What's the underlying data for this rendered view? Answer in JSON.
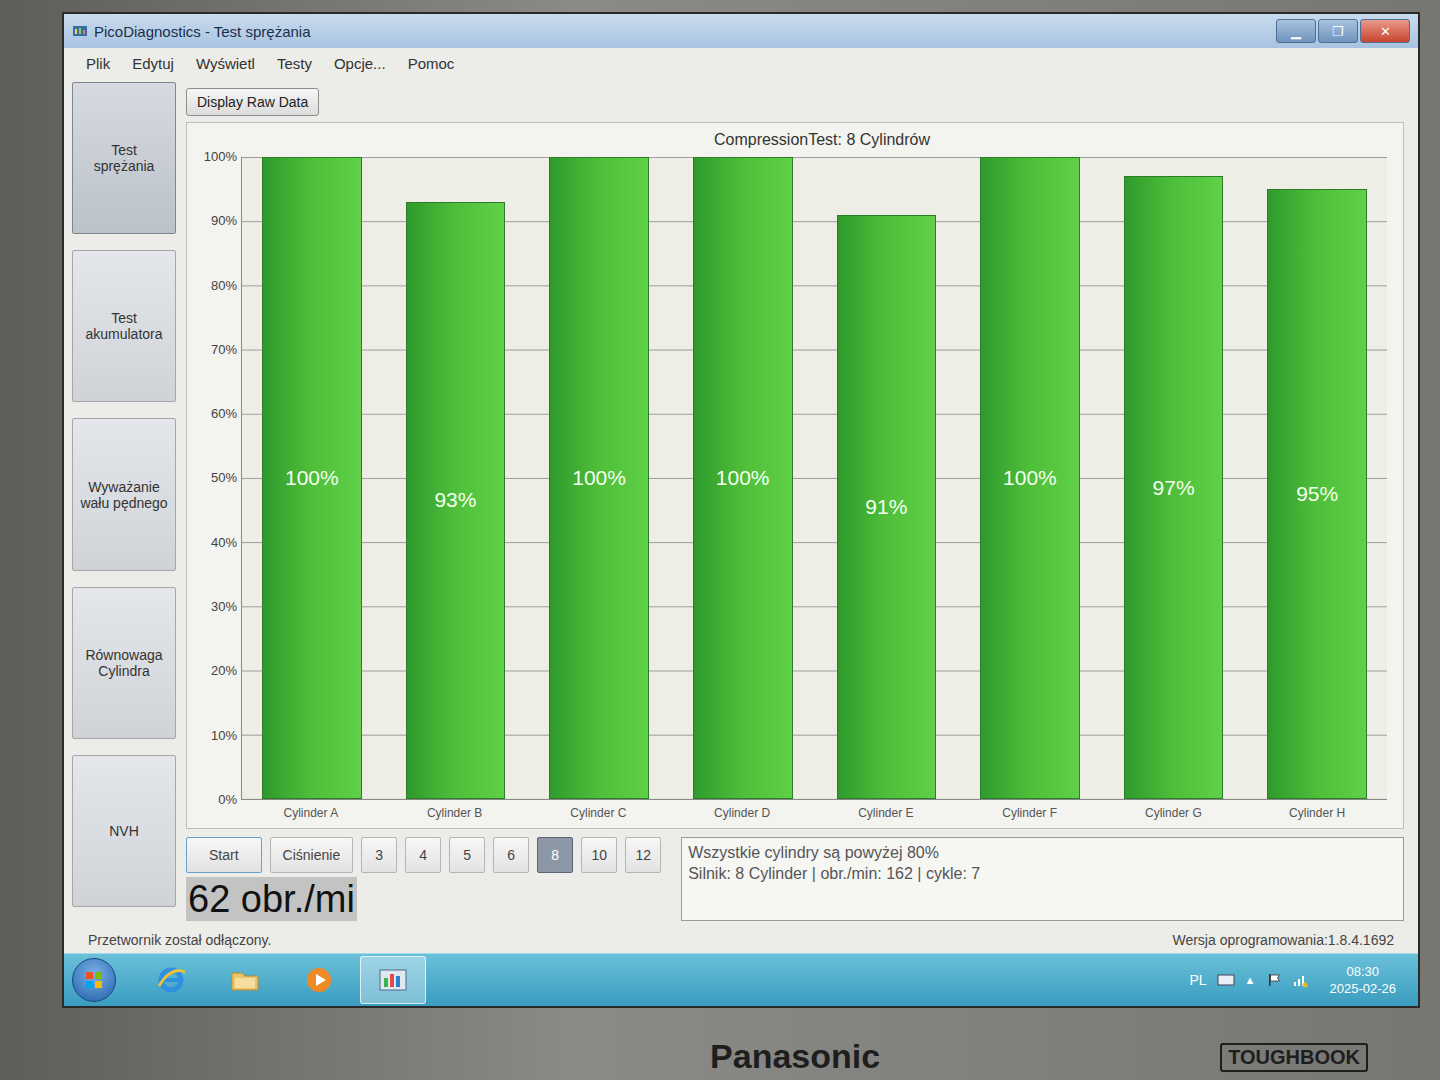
{
  "device": {
    "brand": "Panasonic",
    "model": "TOUGHBOOK"
  },
  "window": {
    "title": "PicoDiagnostics - Test sprężania",
    "controls": [
      "▁",
      "❐",
      "✕"
    ]
  },
  "menu": [
    "Plik",
    "Edytuj",
    "Wyświetl",
    "Testy",
    "Opcje...",
    "Pomoc"
  ],
  "sidebar": {
    "items": [
      {
        "label": "Test sprężania",
        "selected": true
      },
      {
        "label": "Test akumulatora",
        "selected": false
      },
      {
        "label": "Wyważanie wału pędnego",
        "selected": false
      },
      {
        "label": "Równowaga Cylindra",
        "selected": false
      },
      {
        "label": "NVH",
        "selected": false
      }
    ]
  },
  "toolbar": {
    "raw_data_button": "Display Raw Data"
  },
  "chart": {
    "title": "CompressionTest: 8 Cylindrów",
    "y_ticks": [
      "100%",
      "90%",
      "80%",
      "70%",
      "60%",
      "50%",
      "40%",
      "30%",
      "20%",
      "10%",
      "0%"
    ],
    "series": [
      {
        "name": "compression",
        "values": [
          100,
          93,
          100,
          100,
          91,
          100,
          97,
          95
        ]
      }
    ],
    "bar_labels": [
      "100%",
      "93%",
      "100%",
      "100%",
      "91%",
      "100%",
      "97%",
      "95%"
    ],
    "categories": [
      "Cylinder A",
      "Cylinder B",
      "Cylinder C",
      "Cylinder D",
      "Cylinder E",
      "Cylinder F",
      "Cylinder G",
      "Cylinder H"
    ]
  },
  "controls": {
    "start": "Start",
    "pressure": "Ciśnienie",
    "cylinder_counts": [
      {
        "label": "3",
        "selected": false
      },
      {
        "label": "4",
        "selected": false
      },
      {
        "label": "5",
        "selected": false
      },
      {
        "label": "6",
        "selected": false
      },
      {
        "label": "8",
        "selected": true
      },
      {
        "label": "10",
        "selected": false
      },
      {
        "label": "12",
        "selected": false
      }
    ]
  },
  "summary": {
    "lines": [
      "Wszystkie cylindry są powyżej 80%",
      "Silnik: 8 Cylinder | obr./min: 162 | cykle: 7"
    ]
  },
  "rpm_field": {
    "text": "62 obr./mi",
    "selected": true
  },
  "status_bar": {
    "message": "Przetwornik został odłączony.",
    "version": "Wersja oprogramowania:1.8.4.1692"
  },
  "taskbar": {
    "pinned": [
      {
        "kind": "browser",
        "active": false
      },
      {
        "kind": "folder",
        "active": false
      },
      {
        "kind": "media",
        "active": false
      },
      {
        "kind": "app",
        "active": true
      }
    ],
    "language": "PL",
    "tray_toggle": "▲",
    "clock": {
      "time": "08:30",
      "date": "2025-02-26"
    }
  }
}
